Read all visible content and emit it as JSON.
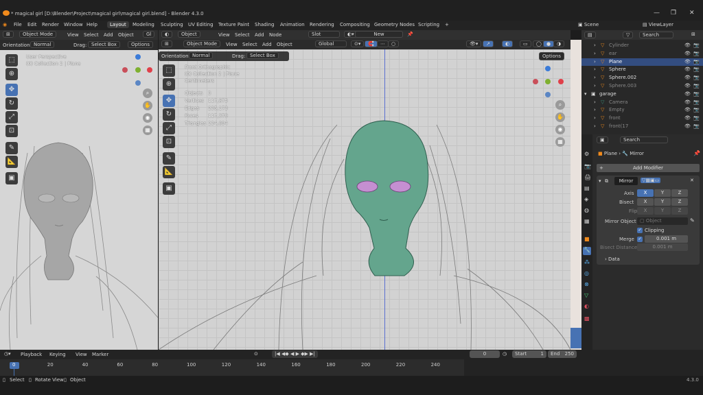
{
  "app": {
    "title": "* magical girl [D:\\Blender\\Project\\magical girl\\magical girl.blend] - Blender 4.3.0",
    "version": "4.3.0"
  },
  "menu": [
    "File",
    "Edit",
    "Render",
    "Window",
    "Help"
  ],
  "workspaces": [
    "Layout",
    "Modeling",
    "Sculpting",
    "UV Editing",
    "Texture Paint",
    "Shading",
    "Animation",
    "Rendering",
    "Compositing",
    "Geometry Nodes",
    "Scripting",
    "+"
  ],
  "active_workspace": "Layout",
  "scene": {
    "label": "Scene",
    "view_layer": "ViewLayer"
  },
  "left_viewport": {
    "header": {
      "mode": "Object Mode",
      "view": "View",
      "select": "Select",
      "add": "Add",
      "object": "Object",
      "gl": "Gl"
    },
    "toolsettings": {
      "orientation_label": "Orientation:",
      "orientation": "Normal",
      "drag_label": "Drag:",
      "drag": "Select Box",
      "options": "Options"
    },
    "overlay": {
      "line1": "User Perspective",
      "line2": "(0) Collection 2 | Plane"
    }
  },
  "main_viewport": {
    "header": {
      "mode": "Object Mode",
      "view": "View",
      "select": "Select",
      "add": "Add",
      "object": "Object"
    },
    "toolsettings": {
      "orientation_label": "Orientation:",
      "orientation": "Normal",
      "drag_label": "Drag:",
      "drag": "Select Box",
      "transform": "Global",
      "options": "Options"
    },
    "overlay": {
      "line1": "Front Orthographic",
      "line2": "(0) Collection 2 | Plane",
      "line3": "Centimeters",
      "stats": [
        [
          "Objects",
          "3"
        ],
        [
          "Vertices",
          "117,875"
        ],
        [
          "Edges",
          "235,173"
        ],
        [
          "Faces",
          "117,379"
        ],
        [
          "Triangles",
          "234,894"
        ]
      ]
    }
  },
  "shader_header": {
    "object": "Object",
    "view": "View",
    "select": "Select",
    "add": "Add",
    "node": "Node",
    "slot": "Slot",
    "new": "New"
  },
  "outliner": {
    "search": "Search",
    "items": [
      "Cylinder",
      "ear",
      "Plane",
      "Sphere",
      "Sphere.002",
      "Sphere.003",
      "garage",
      "Camera",
      "Empty",
      "front",
      "front(17"
    ]
  },
  "properties": {
    "search": "Search",
    "breadcrumb_object": "Plane",
    "breadcrumb_modifier": "Mirror",
    "add_modifier": "Add Modifier",
    "modifier_name": "Mirror",
    "axis_label": "Axis",
    "bisect_label": "Bisect",
    "flip_label": "Flip",
    "axes": [
      "X",
      "Y",
      "Z"
    ],
    "mirror_object_label": "Mirror Object",
    "mirror_object_placeholder": "Object",
    "clipping_label": "Clipping",
    "merge_label": "Merge",
    "merge_value": "0.001 m",
    "bisect_distance_label": "Bisect Distance",
    "bisect_distance_value": "0.001 m",
    "data_label": "Data"
  },
  "timeline": {
    "playback": "Playback",
    "keying": "Keying",
    "view": "View",
    "marker": "Marker",
    "current_frame": "0",
    "start_label": "Start",
    "start": "1",
    "end_label": "End",
    "end": "250",
    "ticks": [
      "0",
      "20",
      "40",
      "60",
      "80",
      "100",
      "120",
      "140",
      "160",
      "180",
      "200",
      "220",
      "240"
    ]
  },
  "statusbar": {
    "select": "Select",
    "rotate": "Rotate View",
    "object": "Object",
    "version": "4.3.0"
  }
}
